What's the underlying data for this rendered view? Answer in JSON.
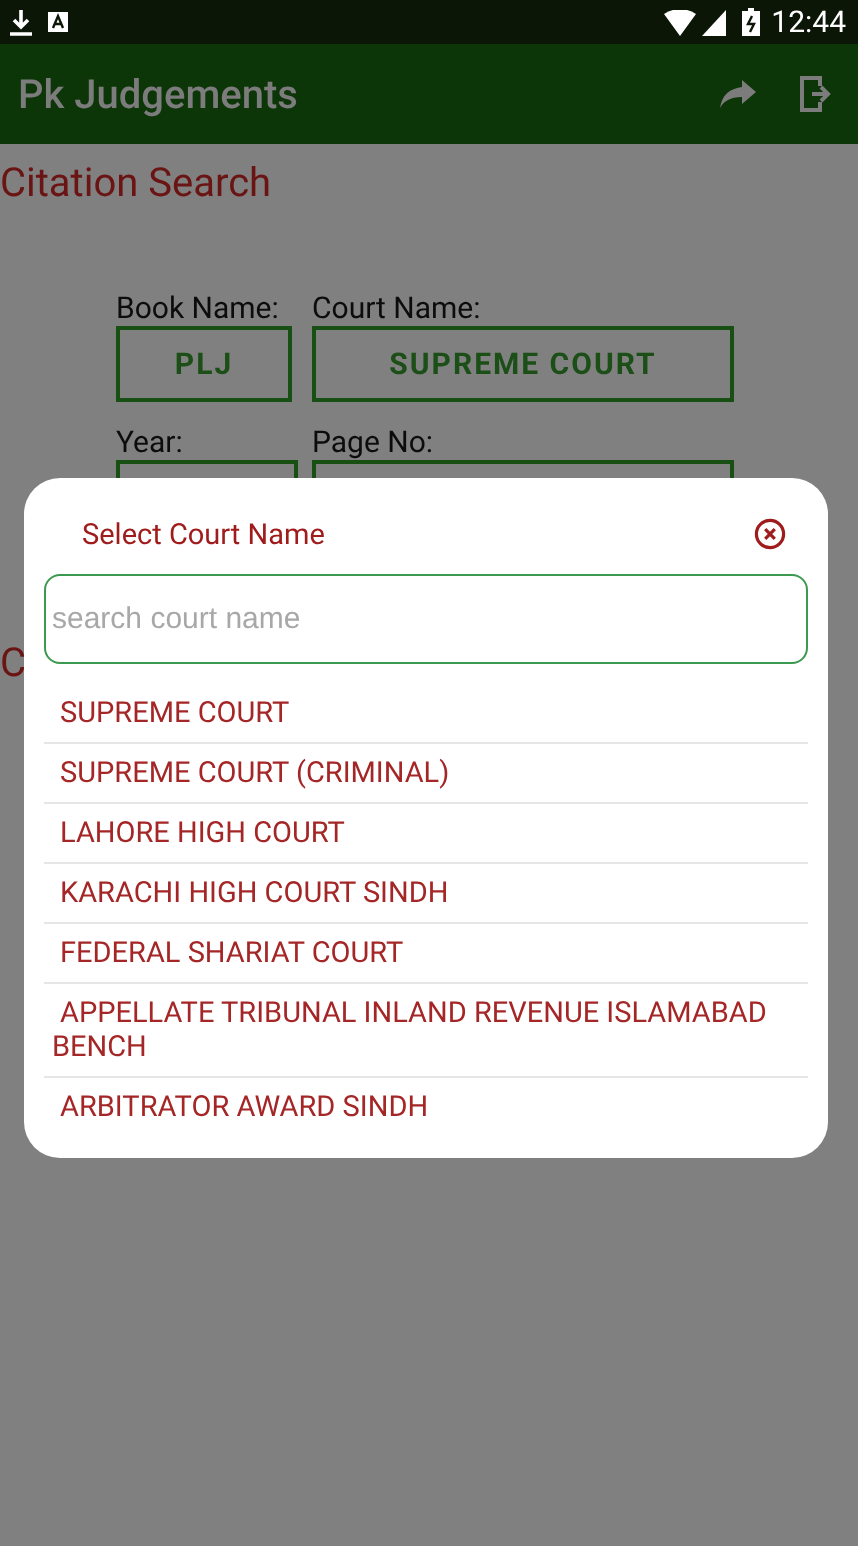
{
  "status_bar": {
    "time": "12:44"
  },
  "app_bar": {
    "title": "Pk Judgements"
  },
  "page": {
    "heading": "Citation Search",
    "book_name": {
      "label": "Book Name:",
      "value": "PLJ"
    },
    "court_name": {
      "label": "Court Name:",
      "value": "SUPREME COURT"
    },
    "year": {
      "label": "Year:"
    },
    "page_no": {
      "label": "Page No:"
    },
    "second_heading": "C"
  },
  "dialog": {
    "title": "Select Court Name",
    "search": {
      "placeholder": "search court name"
    },
    "courts": [
      "SUPREME COURT",
      "SUPREME COURT (CRIMINAL)",
      "LAHORE HIGH COURT",
      "KARACHI HIGH COURT SINDH",
      "FEDERAL SHARIAT COURT",
      "APPELLATE TRIBUNAL INLAND REVENUE ISLAMABAD BENCH",
      "ARBITRATOR AWARD SINDH"
    ]
  }
}
